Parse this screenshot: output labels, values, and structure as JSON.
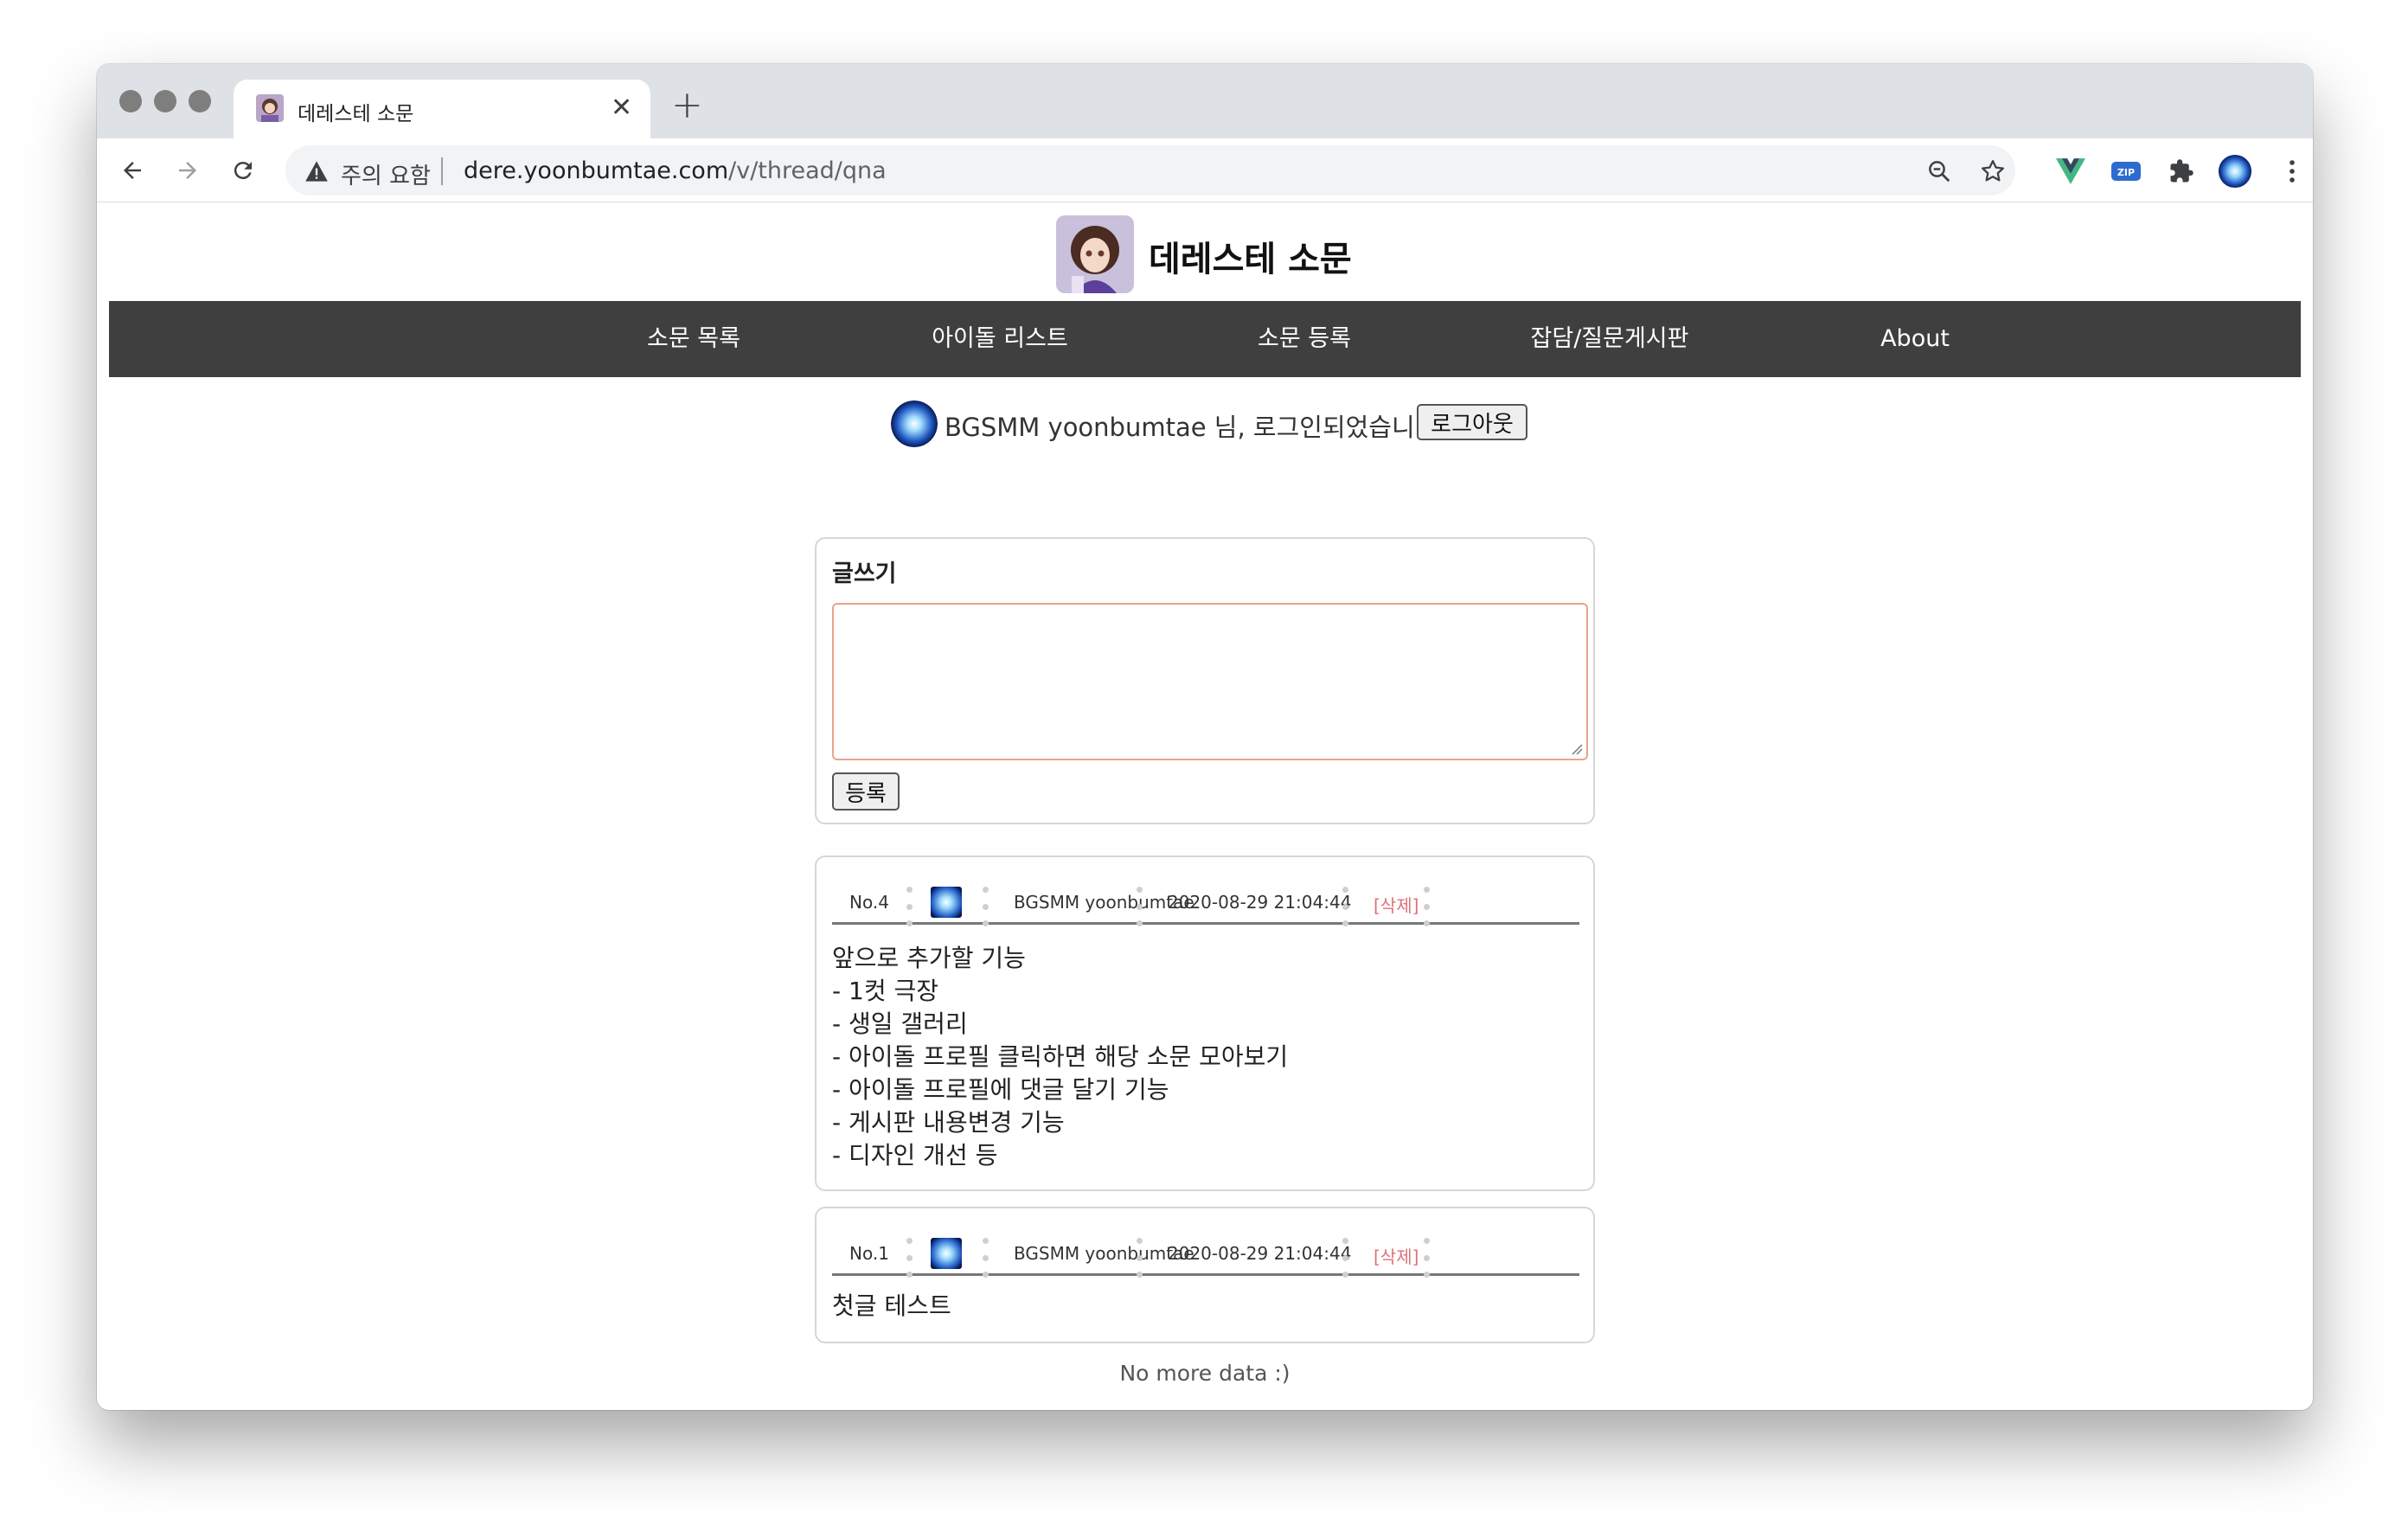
{
  "browser": {
    "tab_title": "데레스테 소문",
    "security_warning": "주의 요함",
    "url_host": "dere.yoonbumtae.com",
    "url_path": "/v/thread/qna"
  },
  "site": {
    "title": "데레스테 소문"
  },
  "nav": {
    "items": [
      {
        "label": "소문 목록"
      },
      {
        "label": "아이돌 리스트"
      },
      {
        "label": "소문 등록"
      },
      {
        "label": "잡담/질문게시판"
      },
      {
        "label": "About"
      }
    ]
  },
  "login": {
    "message": "BGSMM yoonbumtae 님, 로그인되었습니다.",
    "logout_label": "로그아웃"
  },
  "write": {
    "title": "글쓰기",
    "textarea_value": "",
    "submit_label": "등록"
  },
  "posts": [
    {
      "number": "No.4",
      "author": "BGSMM yoonbumtae",
      "datetime": "2020-08-29 21:04:44",
      "delete_label": "[삭제]",
      "body": "앞으로 추가할 기능\n- 1컷 극장\n- 생일 갤러리\n- 아이돌 프로필 클릭하면 해당 소문 모아보기\n- 아이돌 프로필에 댓글 달기 기능\n- 게시판 내용변경 기능\n- 디자인 개선 등"
    },
    {
      "number": "No.1",
      "author": "BGSMM yoonbumtae",
      "datetime": "2020-08-29 21:04:44",
      "delete_label": "[삭제]",
      "body": "첫글 테스트"
    }
  ],
  "footer": {
    "no_more": "No more data :)"
  },
  "colors": {
    "navbar_bg": "#3f3f3f",
    "delete_link": "#e0707a",
    "textarea_border": "#e8a48e"
  }
}
